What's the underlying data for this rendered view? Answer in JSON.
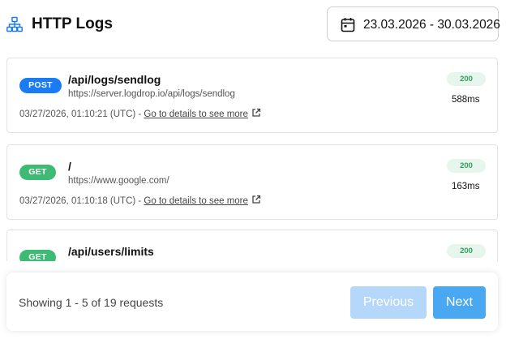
{
  "header": {
    "title": "HTTP Logs",
    "icon": "sitemap-icon",
    "date_range": "23.03.2026 - 30.03.2026",
    "date_icon": "calendar-icon"
  },
  "logs": [
    {
      "method": "POST",
      "path": "/api/logs/sendlog",
      "url": "https://server.logdrop.io/api/logs/sendlog",
      "timestamp": "03/27/2026, 01:10:21 (UTC) - ",
      "details_label": "Go to details to see more",
      "status": "200",
      "duration": "588ms"
    },
    {
      "method": "GET",
      "path": "/",
      "url": "https://www.google.com/",
      "timestamp": "03/27/2026, 01:10:18 (UTC) - ",
      "details_label": "Go to details to see more",
      "status": "200",
      "duration": "163ms"
    },
    {
      "method": "GET",
      "path": "/api/users/limits",
      "status": "200"
    }
  ],
  "pagination": {
    "info": "Showing 1 - 5 of 19 requests",
    "previous_label": "Previous",
    "next_label": "Next"
  },
  "colors": {
    "post": "#1a7cf5",
    "get": "#3dbb74",
    "status_ok_bg": "#e6f6ec",
    "status_ok_text": "#2f9e61",
    "next_button": "#4aa8f3",
    "previous_button_disabled": "#b5d8fa"
  }
}
